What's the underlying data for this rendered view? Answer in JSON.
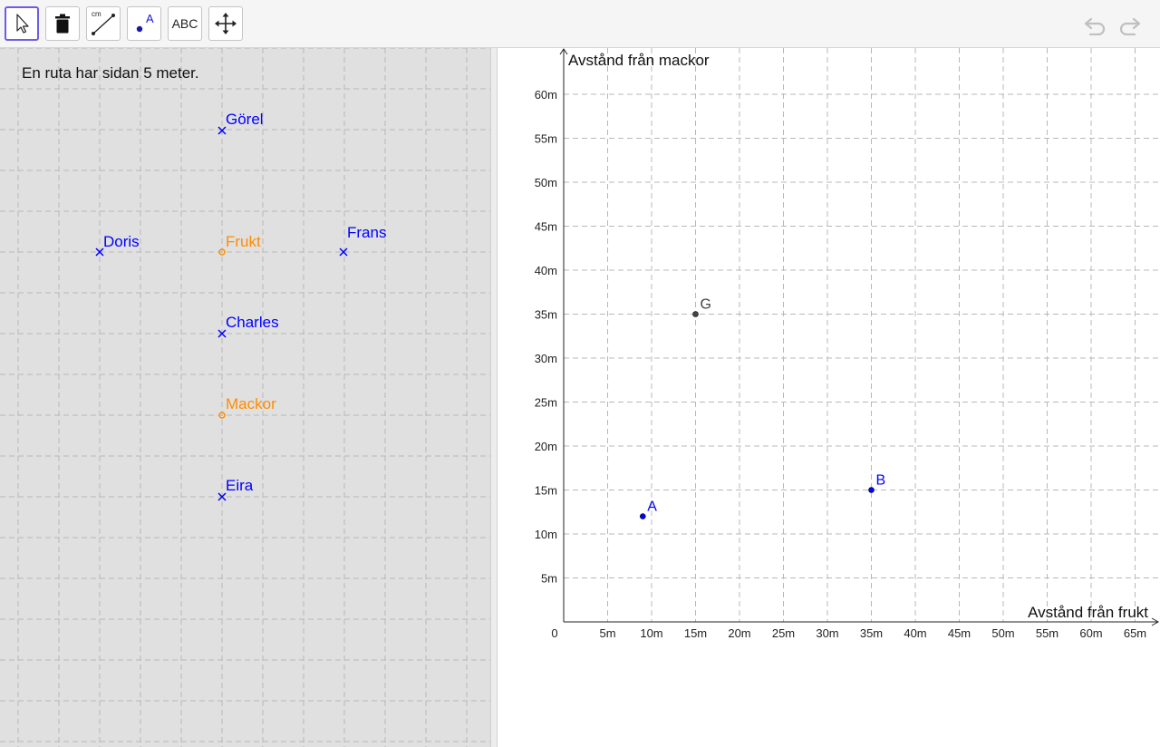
{
  "toolbar": {
    "tools": [
      {
        "name": "move-tool",
        "label": "",
        "icon": "arrow-pointer-icon"
      },
      {
        "name": "delete-tool",
        "label": "",
        "icon": "trash-icon"
      },
      {
        "name": "distance-tool",
        "label": "cm",
        "icon": "measure-distance-icon"
      },
      {
        "name": "point-tool",
        "label": "A",
        "icon": "point-icon"
      },
      {
        "name": "text-tool",
        "label": "ABC",
        "icon": "text-icon"
      },
      {
        "name": "move-view-tool",
        "label": "",
        "icon": "move-graphics-view-icon"
      }
    ],
    "undo_icon": "undo-icon",
    "redo_icon": "redo-icon"
  },
  "left_view": {
    "caption": "En ruta har sidan 5 meter.",
    "points": [
      {
        "label": "Görel",
        "marker": "cross",
        "color": "#0000ff"
      },
      {
        "label": "Doris",
        "marker": "cross",
        "color": "#0000ff"
      },
      {
        "label": "Frukt",
        "marker": "circle",
        "color": "#ff8c00"
      },
      {
        "label": "Frans",
        "marker": "cross",
        "color": "#0000ff"
      },
      {
        "label": "Charles",
        "marker": "cross",
        "color": "#0000ff"
      },
      {
        "label": "Mackor",
        "marker": "circle",
        "color": "#ff8c00"
      },
      {
        "label": "Eira",
        "marker": "cross",
        "color": "#0000ff"
      }
    ]
  },
  "colors": {
    "person_point": "#0000ff",
    "place_point": "#ff8c00",
    "graph_point_blue": "#0000ff",
    "graph_point_gray": "#444444",
    "grid": "#b8b8b8"
  },
  "chart_data": {
    "type": "scatter",
    "xlabel": "Avstånd från frukt",
    "ylabel": "Avstånd från mackor",
    "origin_label": "0",
    "xlim": [
      0,
      68
    ],
    "ylim": [
      0,
      66
    ],
    "grid": true,
    "x_ticks": [
      5,
      10,
      15,
      20,
      25,
      30,
      35,
      40,
      45,
      50,
      55,
      60,
      65
    ],
    "y_ticks": [
      5,
      10,
      15,
      20,
      25,
      30,
      35,
      40,
      45,
      50,
      55,
      60
    ],
    "x_tick_labels": [
      "5m",
      "10m",
      "15m",
      "20m",
      "25m",
      "30m",
      "35m",
      "40m",
      "45m",
      "50m",
      "55m",
      "60m",
      "65m"
    ],
    "y_tick_labels": [
      "5m",
      "10m",
      "15m",
      "20m",
      "25m",
      "30m",
      "35m",
      "40m",
      "45m",
      "50m",
      "55m",
      "60m"
    ],
    "points": [
      {
        "label": "A",
        "x": 9,
        "y": 12,
        "color": "#0000ff"
      },
      {
        "label": "B",
        "x": 35,
        "y": 15,
        "color": "#0000ff"
      },
      {
        "label": "G",
        "x": 15,
        "y": 35,
        "color": "#444444"
      }
    ]
  }
}
